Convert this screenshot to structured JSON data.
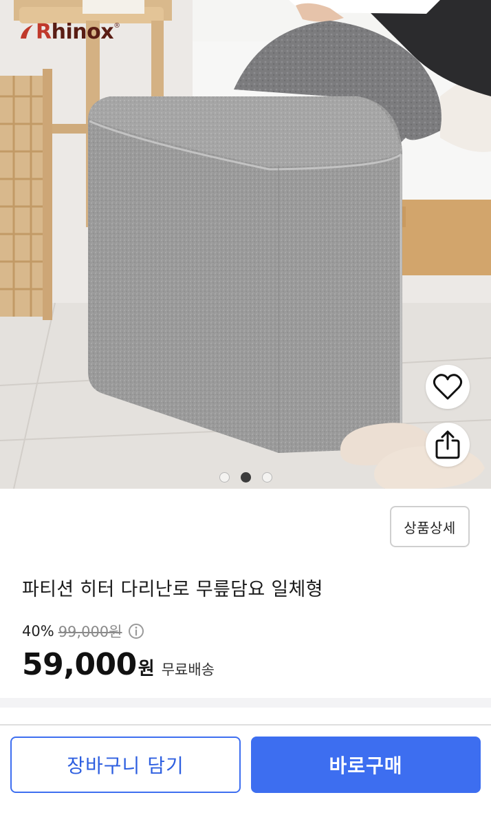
{
  "brand": {
    "logo_text": "Rhinox",
    "logo_lead": "R",
    "logo_rest": "hinox",
    "reg_mark": "®"
  },
  "gallery": {
    "total_images": 3,
    "current_index": 2
  },
  "actions": {
    "like_icon": "heart-icon",
    "share_icon": "share-icon"
  },
  "product": {
    "detail_button": "상품상세",
    "title": "파티션 히터 다리난로 무릎담요 일체형",
    "discount": "40%",
    "original_price": "99,000원",
    "price": "59,000",
    "currency": "원",
    "shipping": "무료배송",
    "info_icon": "info-icon"
  },
  "footer": {
    "cart_button": "장바구니 담기",
    "buy_button": "바로구매"
  },
  "colors": {
    "accent": "#3d6ef0",
    "brand_red": "#c0392b",
    "brand_dark": "#5a1d14"
  }
}
